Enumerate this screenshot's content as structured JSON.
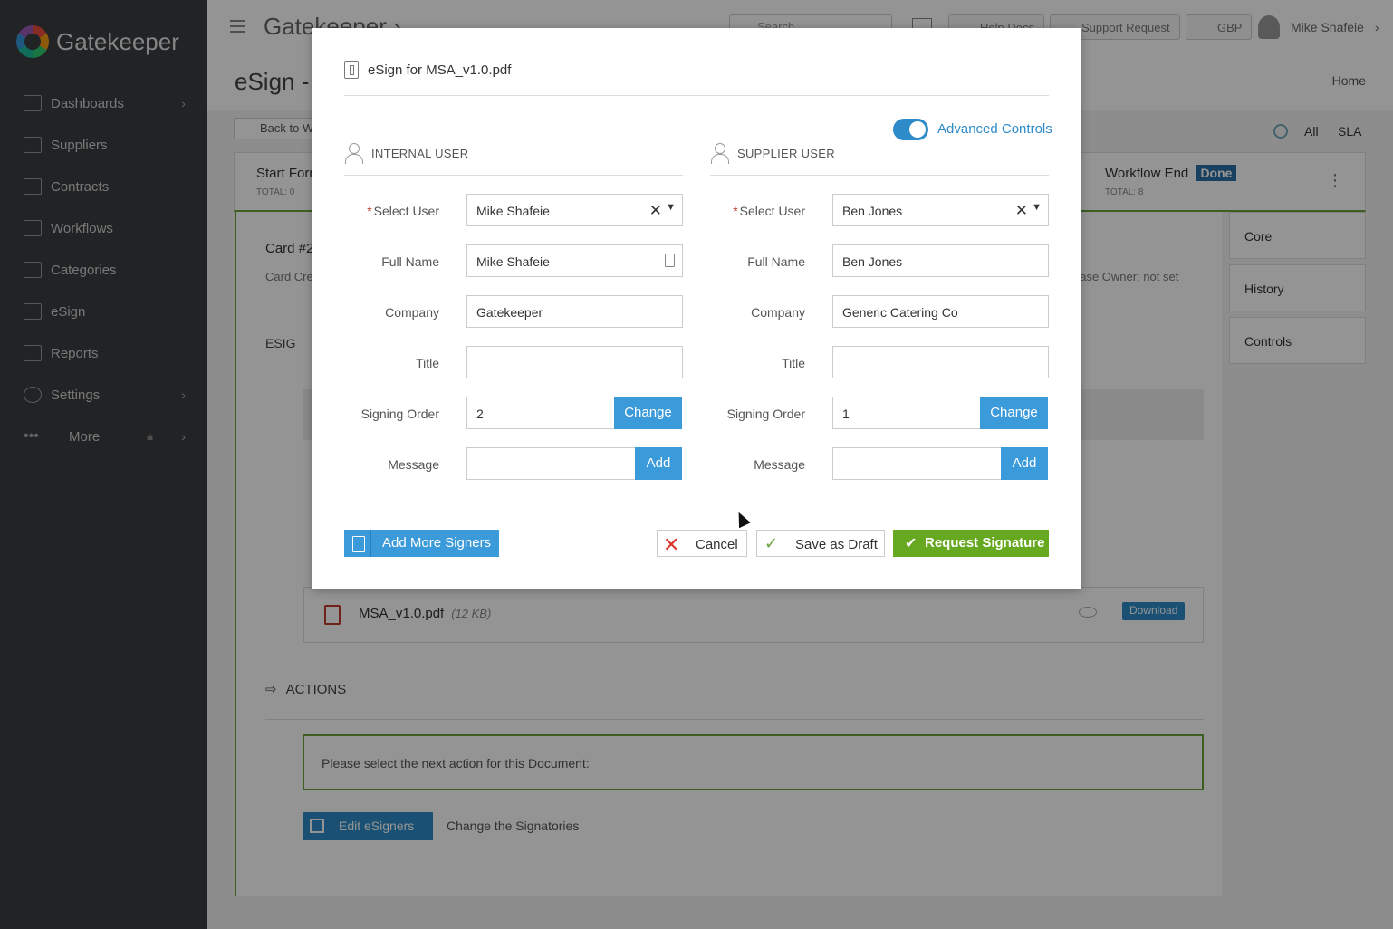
{
  "sidebar": {
    "brand": "Gatekeeper",
    "items": [
      {
        "label": "Dashboards",
        "icon": "monitor-icon",
        "chevron": "›"
      },
      {
        "label": "Suppliers",
        "icon": "briefcase-icon",
        "chevron": ""
      },
      {
        "label": "Contracts",
        "icon": "document-icon",
        "chevron": ""
      },
      {
        "label": "Workflows",
        "icon": "grid-icon",
        "chevron": ""
      },
      {
        "label": "Categories",
        "icon": "folder-icon",
        "chevron": ""
      },
      {
        "label": "eSign",
        "icon": "signature-icon",
        "chevron": ""
      },
      {
        "label": "Reports",
        "icon": "bar-chart-icon",
        "chevron": ""
      },
      {
        "label": "Settings",
        "icon": "gear-icon",
        "chevron": "›"
      },
      {
        "label": "More",
        "icon": "dots-icon",
        "chevron": "›"
      }
    ]
  },
  "topbar": {
    "title": "Gatekeeper ›",
    "search_placeholder": "Search",
    "help_docs": "Help Docs",
    "support_request": "Support Request",
    "currency": "GBP",
    "user_name": "Mike Shafeie",
    "user_chevron": "›"
  },
  "page": {
    "title": "eSign - /",
    "home": "Home",
    "back": "Back to Wo",
    "filter_all": "All",
    "filter_sla": "SLA"
  },
  "stages": {
    "start_label": "Start Form",
    "start_total": "TOTAL: 0",
    "end_label": "Workflow End",
    "end_badge": "Done",
    "end_total": "TOTAL: 8",
    "kebab": "⋮"
  },
  "card": {
    "number": "Card #2",
    "created": "Card Cre",
    "owner": "hase Owner: not set",
    "esig_section": "ESIG",
    "file_name": "MSA_v1.0.pdf",
    "file_size": "(12 KB)",
    "download": "Download",
    "actions_heading": "ACTIONS",
    "next_action": "Please select the next action for this Document:",
    "edit_signers": "Edit eSigners",
    "change_signatories": "Change the Signatories"
  },
  "side_tabs": [
    "Core",
    "History",
    "Controls"
  ],
  "modal": {
    "title": "eSign for MSA_v1.0.pdf",
    "advanced_controls": "Advanced Controls",
    "internal": {
      "heading": "INTERNAL USER",
      "select_user_label": "Select User",
      "select_user": "Mike Shafeie",
      "full_name_label": "Full Name",
      "full_name": "Mike Shafeie",
      "company_label": "Company",
      "company": "Gatekeeper",
      "title_label": "Title",
      "title": "",
      "signing_order_label": "Signing Order",
      "signing_order": "2",
      "change": "Change",
      "message_label": "Message",
      "message": "",
      "add": "Add"
    },
    "supplier": {
      "heading": "SUPPLIER USER",
      "select_user_label": "Select User",
      "select_user": "Ben Jones",
      "full_name_label": "Full Name",
      "full_name": "Ben Jones",
      "company_label": "Company",
      "company": "Generic Catering Co",
      "title_label": "Title",
      "title": "",
      "signing_order_label": "Signing Order",
      "signing_order": "1",
      "change": "Change",
      "message_label": "Message",
      "message": "",
      "add": "Add"
    },
    "add_more_signers": "Add More Signers",
    "cancel": "Cancel",
    "save_draft": "Save as Draft",
    "request_signature": "Request Signature"
  },
  "colors": {
    "sidebar_bg": "#3a3d41",
    "primary_blue": "#3b9ad9",
    "success_green": "#66a81f",
    "danger_red": "#d9342b"
  }
}
